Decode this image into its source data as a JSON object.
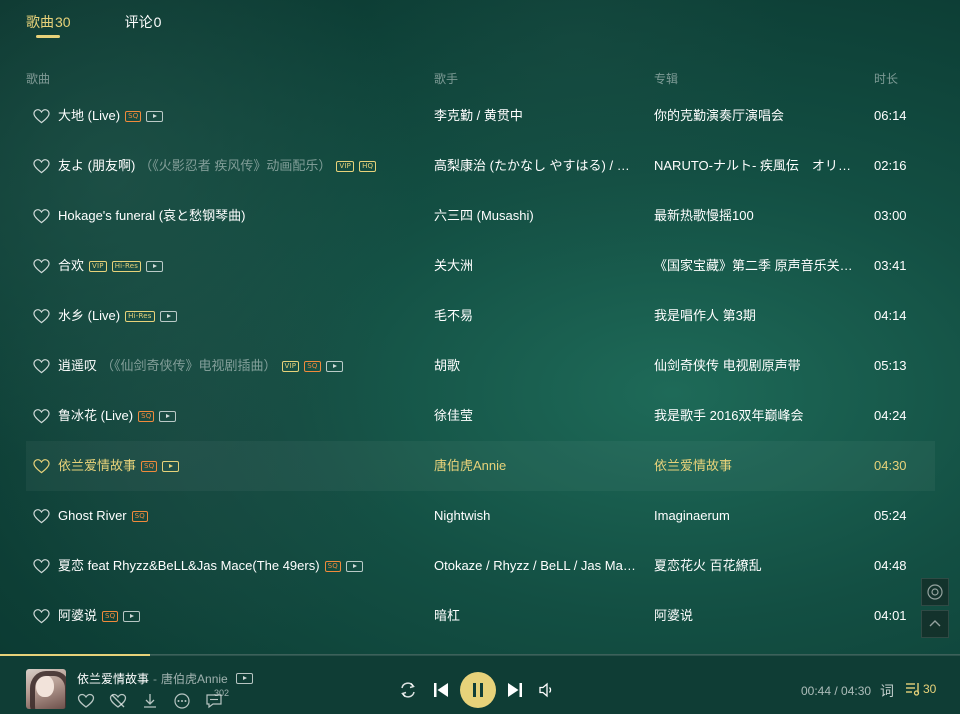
{
  "tabs": [
    {
      "label": "歌曲",
      "count": "30",
      "active": true
    },
    {
      "label": "评论",
      "count": "0",
      "active": false
    }
  ],
  "columns": {
    "song": "歌曲",
    "singer": "歌手",
    "album": "专辑",
    "duration": "时长"
  },
  "songs": [
    {
      "name": "大地 (Live)",
      "sub": "",
      "badges": [
        "SQ"
      ],
      "mv": true,
      "singer": "李克勤 / 黄贯中",
      "album": "你的克勤演奏厅演唱会",
      "duration": "06:14"
    },
    {
      "name": "友よ (朋友啊)",
      "sub": "（《火影忍者 疾风传》动画配乐）",
      "badges": [
        "VIP",
        "HQ"
      ],
      "mv": false,
      "singer": "高梨康治 (たかなし やすはる) / …",
      "album": "NARUTO-ナルト- 疾風伝　オリジ…",
      "duration": "02:16"
    },
    {
      "name": "Hokage's funeral (哀と愁钢琴曲)",
      "sub": "",
      "badges": [],
      "mv": false,
      "singer": "六三四 (Musashi)",
      "album": "最新热歌慢摇100",
      "duration": "03:00"
    },
    {
      "name": "合欢",
      "sub": "",
      "badges": [
        "VIP",
        "Hi-Res"
      ],
      "mv": true,
      "singer": "关大洲",
      "album": "《国家宝藏》第二季 原声音乐关…",
      "duration": "03:41"
    },
    {
      "name": "水乡 (Live)",
      "sub": "",
      "badges": [
        "Hi-Res"
      ],
      "mv": true,
      "singer": "毛不易",
      "album": "我是唱作人 第3期",
      "duration": "04:14"
    },
    {
      "name": "逍遥叹",
      "sub": "（《仙剑奇侠传》电视剧插曲）",
      "badges": [
        "VIP",
        "SQ"
      ],
      "mv": true,
      "singer": "胡歌",
      "album": "仙剑奇侠传 电视剧原声带",
      "duration": "05:13"
    },
    {
      "name": "鲁冰花 (Live)",
      "sub": "",
      "badges": [
        "SQ"
      ],
      "mv": true,
      "singer": "徐佳莹",
      "album": "我是歌手 2016双年巅峰会",
      "duration": "04:24"
    },
    {
      "name": "依兰爱情故事",
      "sub": "",
      "badges": [
        "SQ"
      ],
      "mv": true,
      "singer": "唐伯虎Annie",
      "album": "依兰爱情故事",
      "duration": "04:30",
      "playing": true
    },
    {
      "name": "Ghost River",
      "sub": "",
      "badges": [
        "SQ"
      ],
      "mv": false,
      "singer": "Nightwish",
      "album": "Imaginaerum",
      "duration": "05:24"
    },
    {
      "name": "夏恋 feat Rhyzz&BeLL&Jas Mace(The 49ers)",
      "sub": "",
      "badges": [
        "SQ"
      ],
      "mv": true,
      "singer": "Otokaze / Rhyzz / BeLL / Jas Mace",
      "album": "夏恋花火 百花繚乱",
      "duration": "04:48"
    },
    {
      "name": "阿婆说",
      "sub": "",
      "badges": [
        "SQ"
      ],
      "mv": true,
      "singer": "暗杠",
      "album": "阿婆说",
      "duration": "04:01"
    }
  ],
  "player": {
    "title": "依兰爱情故事",
    "separator": "-",
    "artist": "唐伯虎Annie",
    "comment_count": "302",
    "current_time": "00:44",
    "total_time": "04:30",
    "time_separator": " / ",
    "progress": 0.156,
    "lyric_label": "词",
    "queue_count": "30"
  },
  "colors": {
    "accent": "#e7d27a",
    "sq_badge": "#f08a3c",
    "background": "#134f43"
  }
}
